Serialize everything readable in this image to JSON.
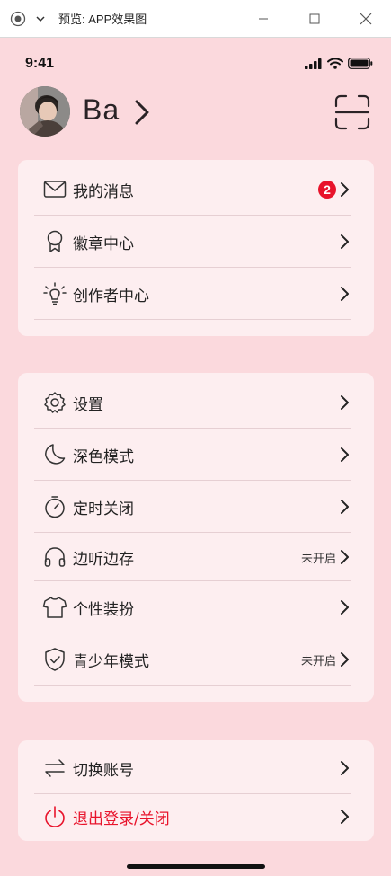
{
  "window": {
    "title": "预览: APP效果图",
    "icons": [
      "record-icon",
      "chevron-down-icon",
      "minimize-icon",
      "maximize-icon",
      "close-icon"
    ]
  },
  "status_bar": {
    "time": "9:41"
  },
  "profile": {
    "name": "Ba"
  },
  "groups": [
    {
      "items": [
        {
          "icon": "mail-icon",
          "label": "我的消息",
          "badge": "2"
        },
        {
          "icon": "badge-icon",
          "label": "徽章中心"
        },
        {
          "icon": "bulb-icon",
          "label": "创作者中心"
        }
      ]
    },
    {
      "items": [
        {
          "icon": "gear-icon",
          "label": "设置"
        },
        {
          "icon": "moon-icon",
          "label": "深色模式"
        },
        {
          "icon": "timer-icon",
          "label": "定时关闭"
        },
        {
          "icon": "headphones-icon",
          "label": "边听边存",
          "value": "未开启"
        },
        {
          "icon": "shirt-icon",
          "label": "个性装扮"
        },
        {
          "icon": "shield-icon",
          "label": "青少年模式",
          "value": "未开启"
        }
      ]
    },
    {
      "items": [
        {
          "icon": "switch-icon",
          "label": "切换账号"
        },
        {
          "icon": "power-icon",
          "label": "退出登录/关闭"
        }
      ]
    }
  ],
  "colors": {
    "background": "#fbd9dd",
    "card": "#fdeef0",
    "danger": "#e8132b"
  }
}
